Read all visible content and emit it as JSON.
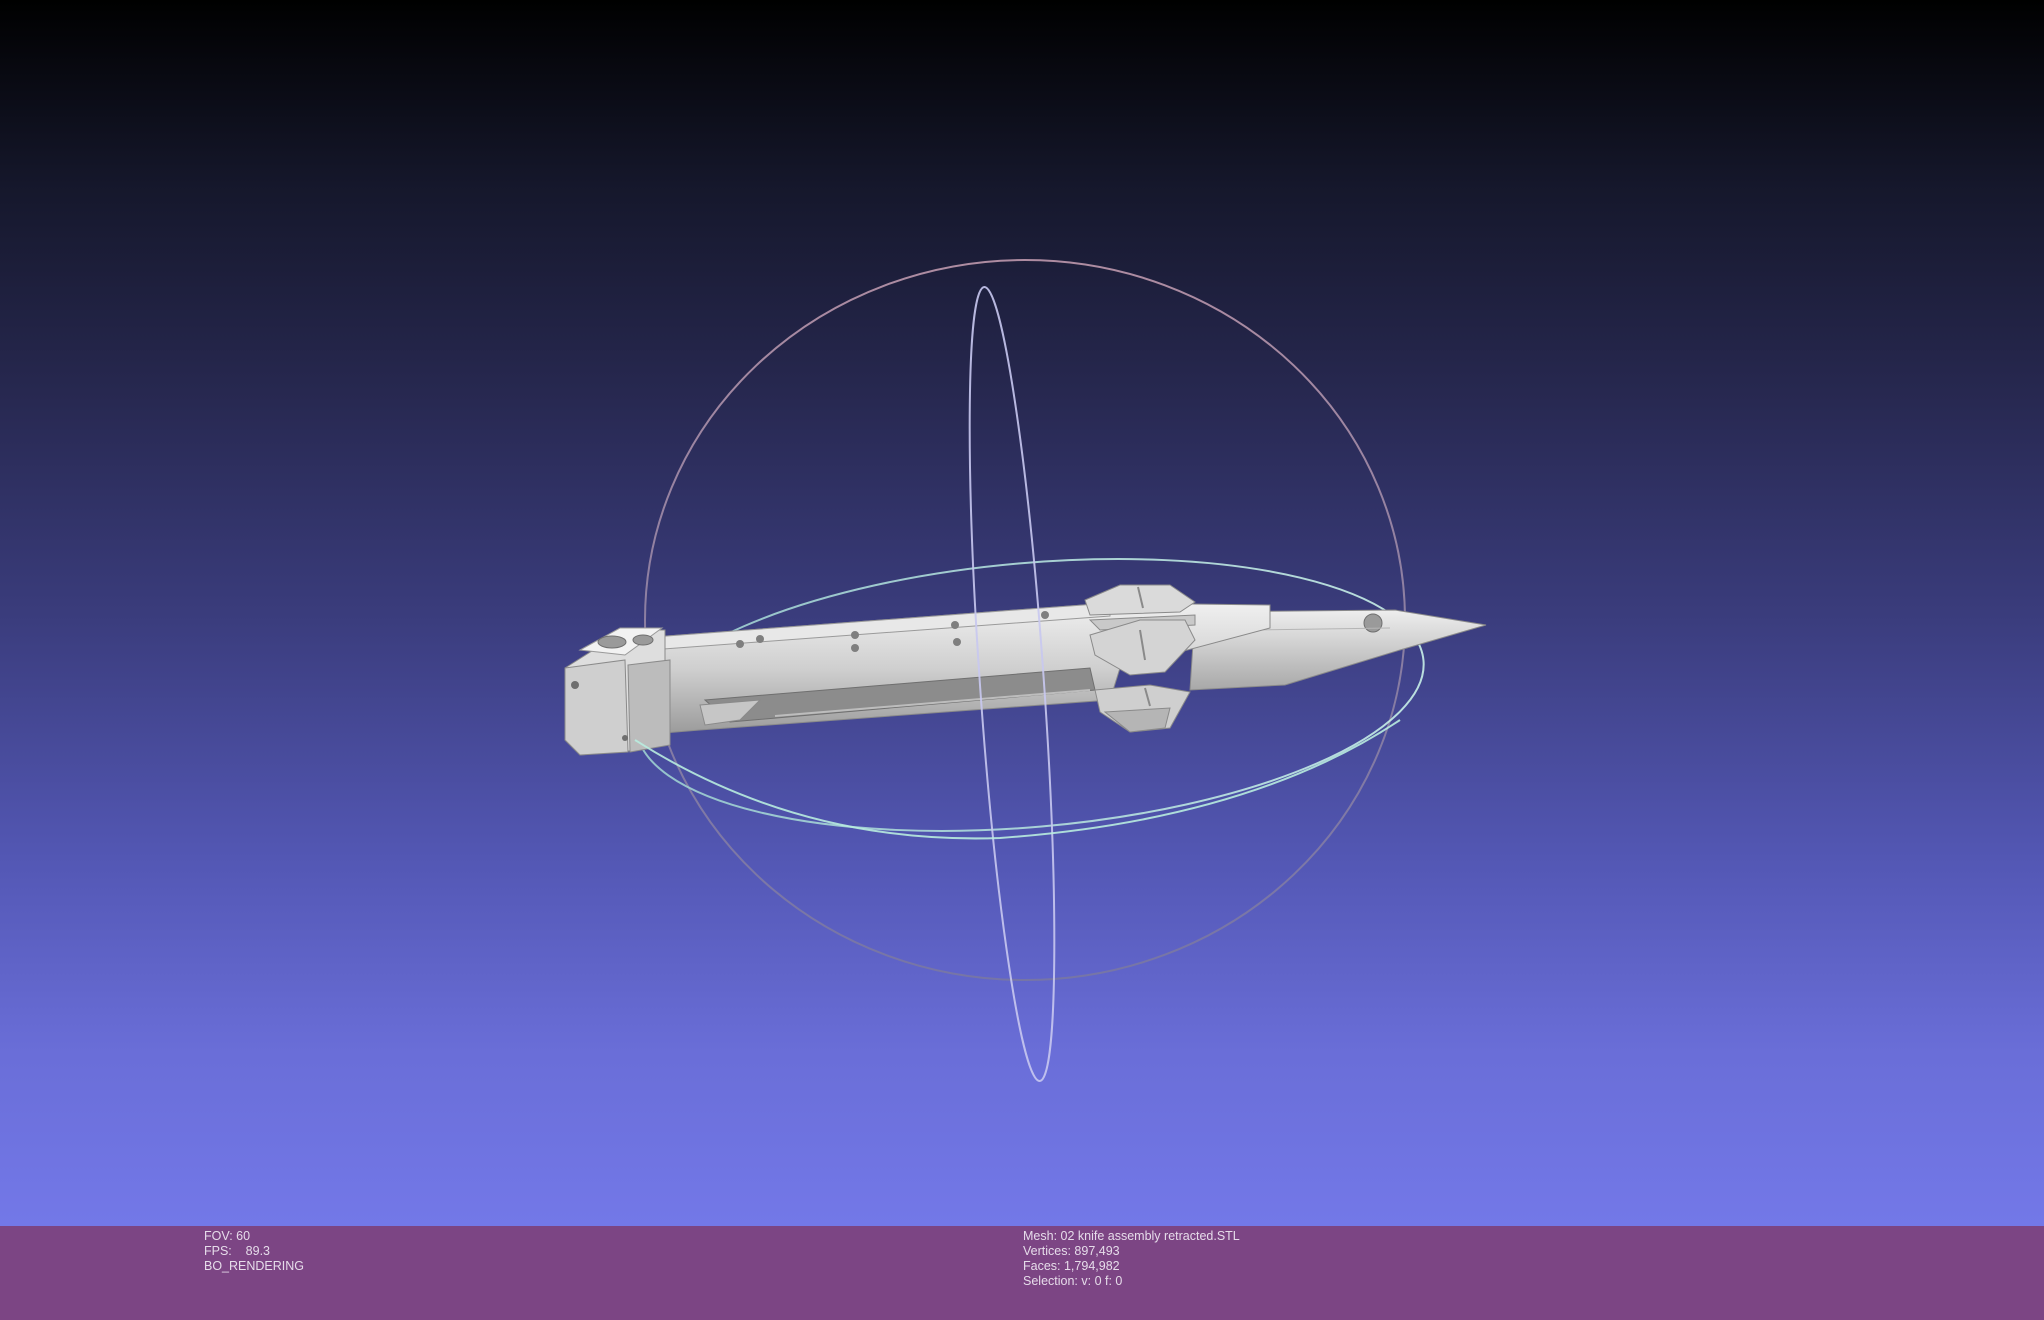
{
  "viewport": {
    "background_top": "#000000",
    "background_bottom": "#7378e8",
    "trackball_colors": {
      "horizontal_ring": "#a8e4e0",
      "vertical_ring": "#c8c8f0",
      "outer_ring": "#c8a0b4"
    },
    "mesh_color": "#d9d9d9"
  },
  "info_left": {
    "fov": "FOV: 60",
    "fps": "FPS:    89.3",
    "mode": "BO_RENDERING"
  },
  "info_right": {
    "mesh": "Mesh: 02 knife assembly retracted.STL",
    "vertices": "Vertices: 897,493",
    "faces": "Faces: 1,794,982",
    "selection": "Selection: v: 0 f: 0"
  },
  "info_bar_color": "#7c4584"
}
